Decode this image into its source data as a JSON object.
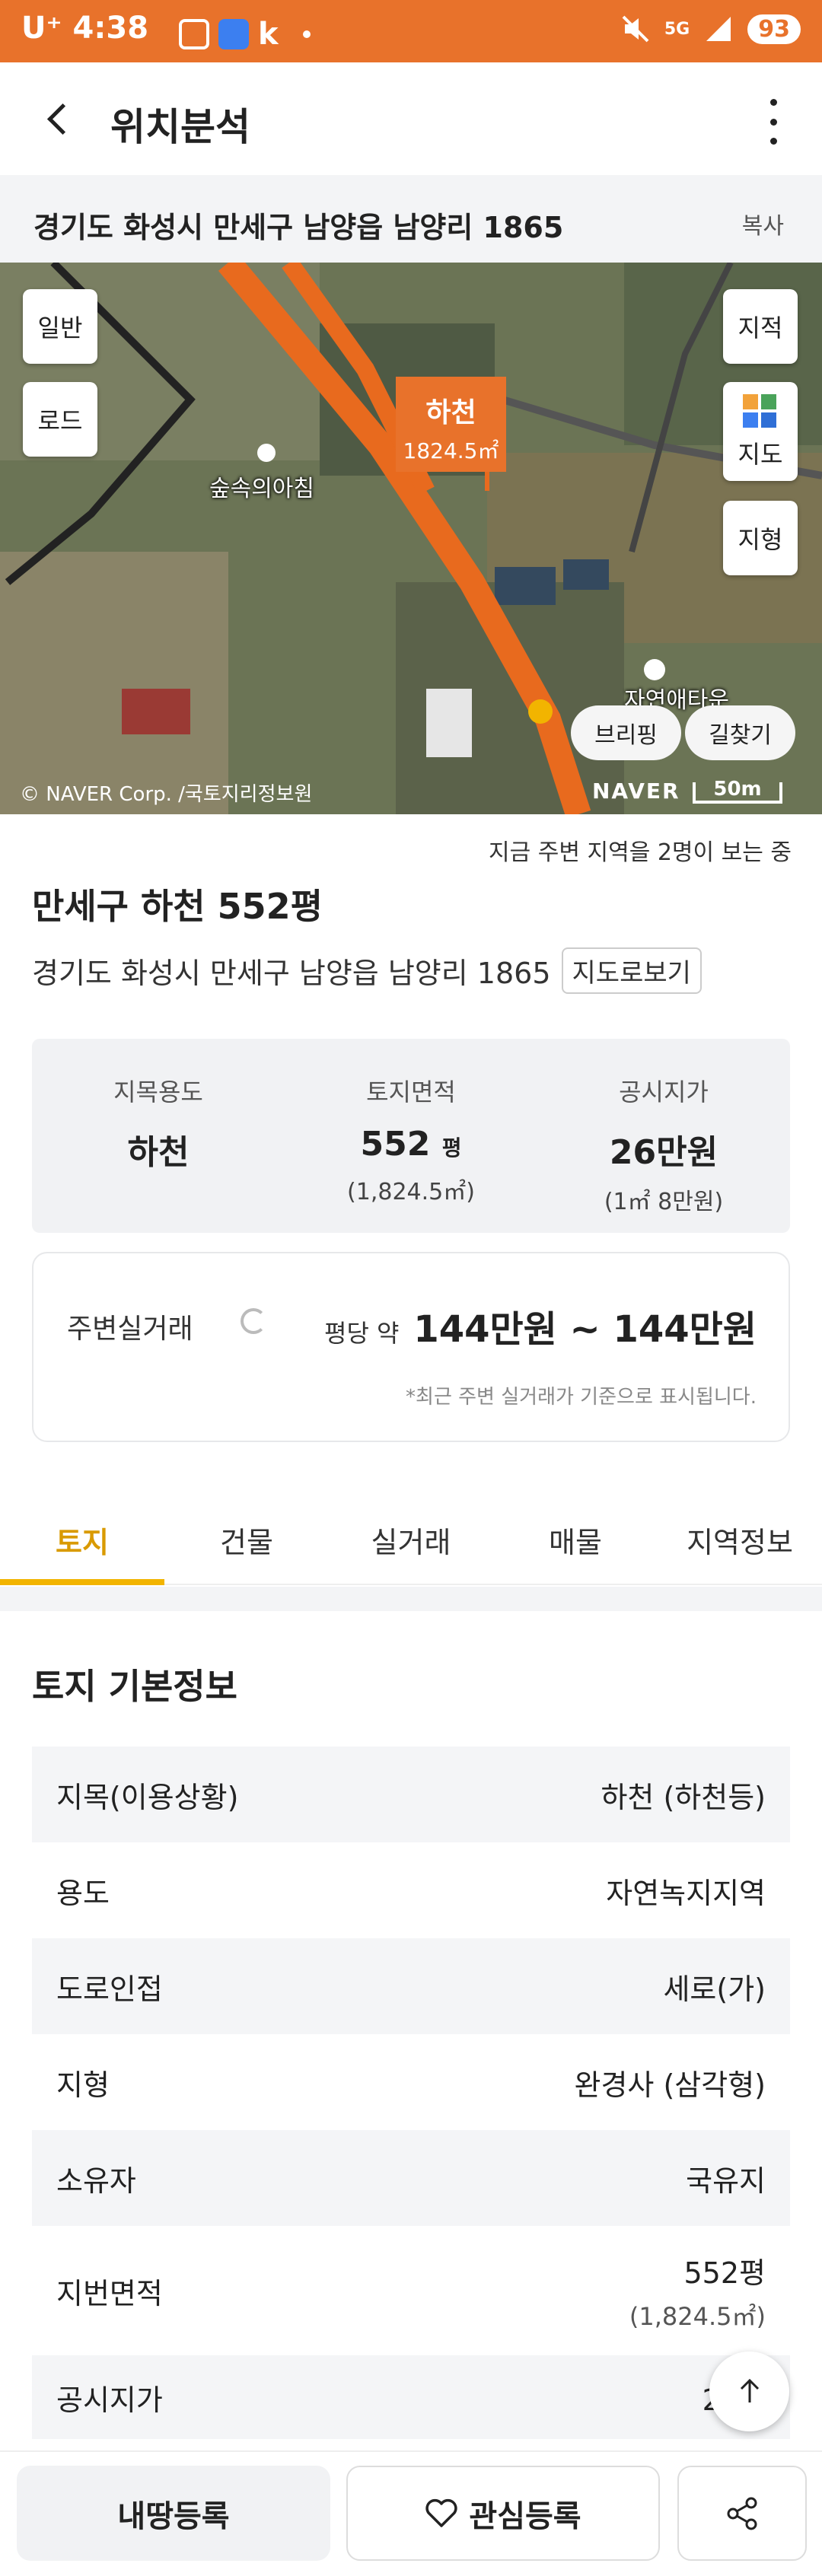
{
  "status_bar": {
    "carrier": "U⁺",
    "time": "4:38",
    "app_icon_k": "k",
    "network": "5G",
    "battery": "93"
  },
  "header": {
    "title": "위치분석"
  },
  "address_bar": {
    "address": "경기도 화성시 만세구 남양읍 남양리 1865",
    "copy_label": "복사"
  },
  "map": {
    "btn_general": "일반",
    "btn_road": "로드",
    "btn_cadastral": "지적",
    "btn_map": "지도",
    "btn_terrain": "지형",
    "parcel_name": "하천",
    "parcel_area": "1824.5㎡",
    "poi_1": "숲속의아침",
    "poi_2": "자연애타운",
    "pill_briefing": "브리핑",
    "pill_directions": "길찾기",
    "credit": "© NAVER Corp. /국토지리정보원",
    "naver_logo": "NAVER",
    "scale": "50m"
  },
  "viewers_note": "지금 주변 지역을 2명이 보는 중",
  "land": {
    "title": "만세구 하천 552평",
    "address": "경기도 화성시 만세구 남양읍 남양리 1865",
    "road_view_label": "지도로보기"
  },
  "summary": {
    "use_label": "지목용도",
    "use_value": "하천",
    "area_label": "토지면적",
    "area_value": "552",
    "area_unit": "평",
    "area_sub": "(1,824.5㎡)",
    "price_label": "공시지가",
    "price_value": "26만원",
    "price_sub": "(1㎡ 8만원)"
  },
  "deal": {
    "label": "주변실거래",
    "prefix": "평당 약",
    "price": "144만원 ~ 144만원",
    "note": "*최근 주변 실거래가 기준으로 표시됩니다."
  },
  "tabs": [
    "토지",
    "건물",
    "실거래",
    "매물",
    "지역정보"
  ],
  "basic_info": {
    "title": "토지 기본정보",
    "rows": [
      {
        "label": "지목(이용상황)",
        "value": "하천 (하천등)"
      },
      {
        "label": "용도",
        "value": "자연녹지지역"
      },
      {
        "label": "도로인접",
        "value": "세로(가)"
      },
      {
        "label": "지형",
        "value": "완경사 (삼각형)"
      },
      {
        "label": "소유자",
        "value": "국유지"
      },
      {
        "label": "지번면적",
        "value": "552평",
        "sub": "(1,824.5㎡)"
      },
      {
        "label": "공시지가",
        "value": "26만"
      }
    ]
  },
  "bottom_bar": {
    "register_label": "내땅등록",
    "like_label": "관심등록"
  },
  "colors": {
    "accent_orange": "#e8722b",
    "tab_active": "#f2b400"
  }
}
